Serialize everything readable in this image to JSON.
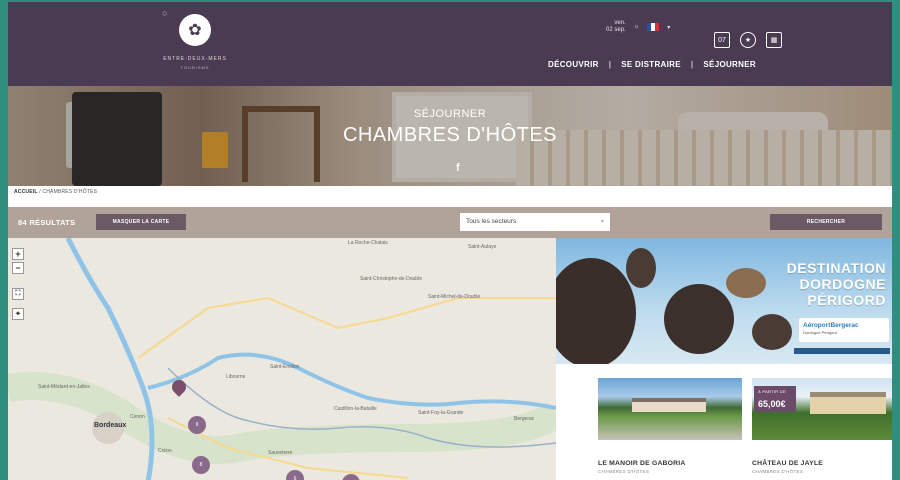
{
  "header": {
    "logo": {
      "name": "ENTRE-DEUX-MERS",
      "sub": "TOURISME"
    },
    "date": {
      "weekday": "ven.",
      "day": "02 sep."
    },
    "icons": [
      "calendar-icon",
      "award-icon",
      "building-icon"
    ],
    "calendar_day": "07",
    "nav": [
      "DÉCOUVRIR",
      "SE DISTRAIRE",
      "SÉJOURNER"
    ],
    "nav_separator": "|"
  },
  "hero": {
    "kicker": "SÉJOURNER",
    "title": "CHAMBRES D'HÔTES",
    "social": "f"
  },
  "breadcrumb": {
    "home": "ACCUEIL",
    "separator": "/",
    "current": "CHAMBRES D'HÔTES"
  },
  "filters": {
    "results": "84 RÉSULTATS",
    "hide_map": "MASQUER LA CARTE",
    "sector": {
      "selected": "Tous les secteurs",
      "caret": "▾"
    },
    "search": "RECHERCHER"
  },
  "map": {
    "controls": {
      "zoom_in": "+",
      "zoom_out": "−",
      "fullscreen": "⛶",
      "locate": "⌖"
    },
    "city": "Bordeaux",
    "clusters": [
      "9",
      "8",
      "6",
      "4"
    ],
    "places": [
      "La Roche-Chalais",
      "Saint-Aulaye",
      "Saint-Christophe-de-Double",
      "Saint-Michel-de-Double",
      "Libourne",
      "Saint-Émilion",
      "Castillon-la-Bataille",
      "Saint-Foy-la-Grande",
      "Bergerac",
      "Saint-Médard-en-Jalles",
      "Cenon",
      "Créon",
      "Sauveterre"
    ]
  },
  "banner": {
    "headline_lines": [
      "DESTINATION",
      "DORDOGNE",
      "PÉRIGORD"
    ],
    "airport": "AéroportBergerac",
    "airport_sub": "Dordogne Périgord"
  },
  "cards": [
    {
      "title": "LE MANOIR DE GABORIA",
      "type": "CHAMBRES D'HÔTES"
    },
    {
      "title": "CHÂTEAU DE JAYLE",
      "type": "CHAMBRES D'HÔTES",
      "price_label": "À PARTIR DE",
      "price": "65,00€"
    }
  ],
  "colors": {
    "header": "#4a3a52",
    "filter_bar": "#b2a39a",
    "accent": "#6b5a66",
    "frame": "#2e8f7e"
  }
}
